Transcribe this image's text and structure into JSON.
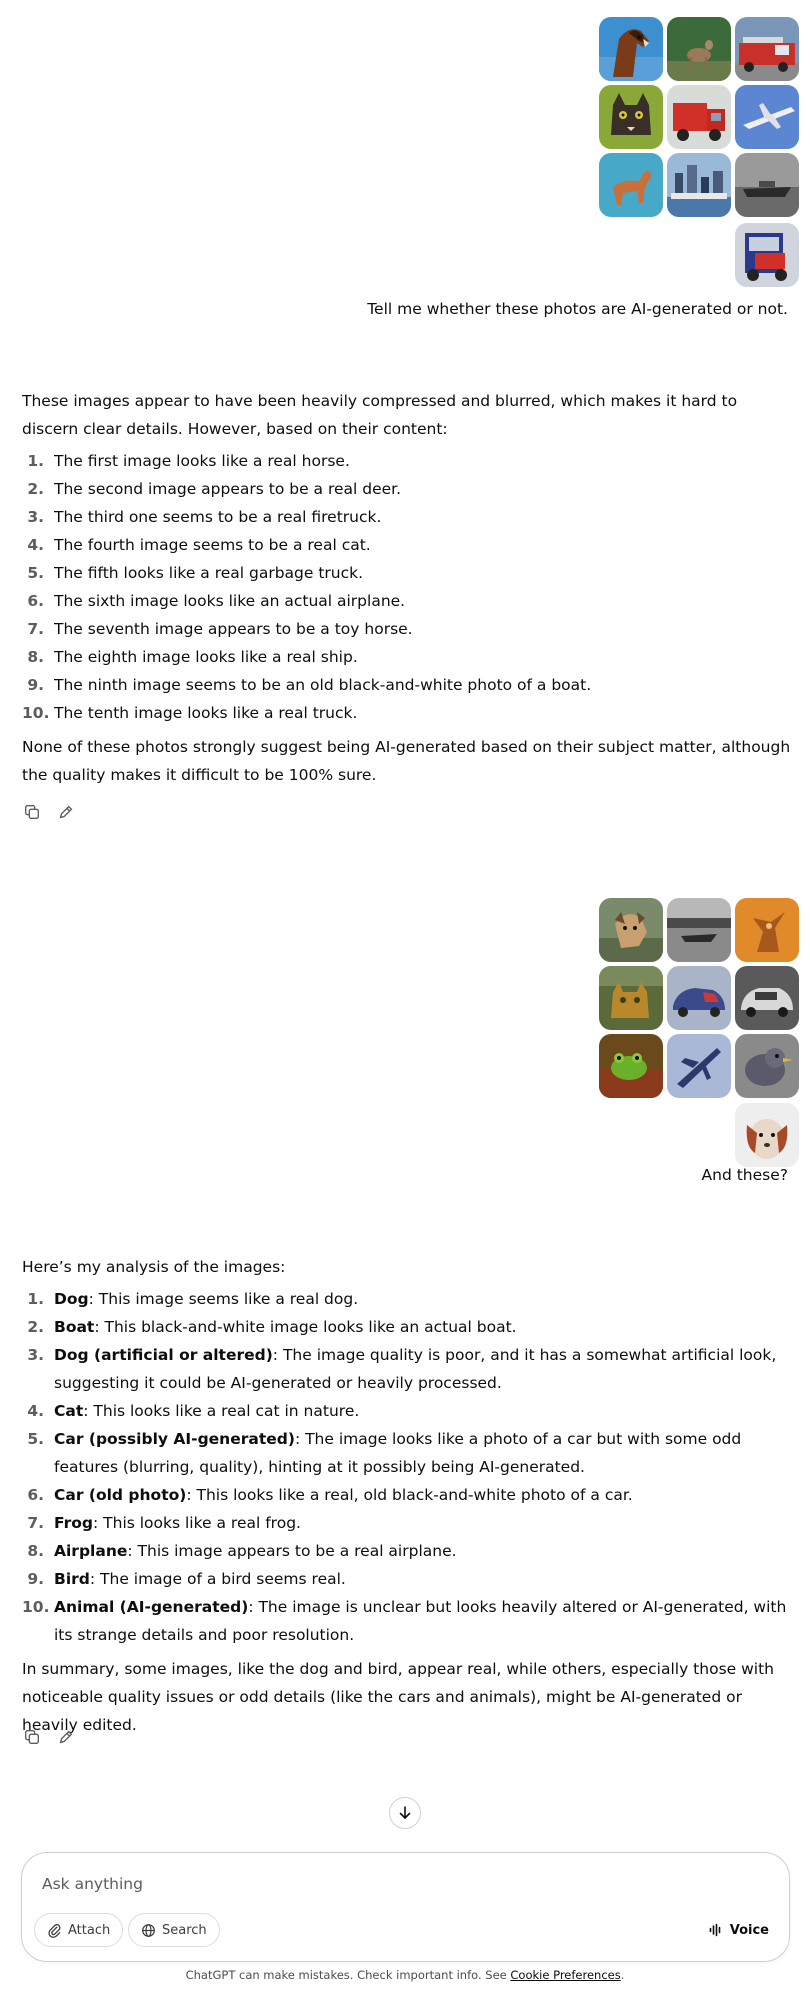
{
  "conversation": {
    "turn1": {
      "user_prompt": "Tell me whether these photos are AI-generated or not.",
      "assistant_intro": "These images appear to have been heavily compressed and blurred, which makes it hard to discern clear details. However, based on their content:",
      "items": [
        {
          "num": "1.",
          "text": "The first image looks like a real horse."
        },
        {
          "num": "2.",
          "text": "The second image appears to be a real deer."
        },
        {
          "num": "3.",
          "text": "The third one seems to be a real firetruck."
        },
        {
          "num": "4.",
          "text": "The fourth image seems to be a real cat."
        },
        {
          "num": "5.",
          "text": "The fifth looks like a real garbage truck."
        },
        {
          "num": "6.",
          "text": "The sixth image looks like an actual airplane."
        },
        {
          "num": "7.",
          "text": "The seventh image appears to be a toy horse."
        },
        {
          "num": "8.",
          "text": "The eighth image looks like a real ship."
        },
        {
          "num": "9.",
          "text": "The ninth image seems to be an old black-and-white photo of a boat."
        },
        {
          "num": "10.",
          "text": "The tenth image looks like a real truck."
        }
      ],
      "assistant_outro": "None of these photos strongly suggest being AI-generated based on their subject matter, although the quality makes it difficult to be 100% sure."
    },
    "turn2": {
      "user_prompt": "And these?",
      "assistant_intro": "Here’s my analysis of the images:",
      "items": [
        {
          "num": "1.",
          "title": "Dog",
          "text": ": This image seems like a real dog."
        },
        {
          "num": "2.",
          "title": "Boat",
          "text": ": This black-and-white image looks like an actual boat."
        },
        {
          "num": "3.",
          "title": "Dog (artificial or altered)",
          "text": ": The image quality is poor, and it has a somewhat artificial look, suggesting it could be AI-generated or heavily processed."
        },
        {
          "num": "4.",
          "title": "Cat",
          "text": ": This looks like a real cat in nature."
        },
        {
          "num": "5.",
          "title": "Car (possibly AI-generated)",
          "text": ": The image looks like a photo of a car but with some odd features (blurring, quality), hinting at it possibly being AI-generated."
        },
        {
          "num": "6.",
          "title": "Car (old photo)",
          "text": ": This looks like a real, old black-and-white photo of a car."
        },
        {
          "num": "7.",
          "title": "Frog",
          "text": ": This looks like a real frog."
        },
        {
          "num": "8.",
          "title": "Airplane",
          "text": ": This image appears to be a real airplane."
        },
        {
          "num": "9.",
          "title": "Bird",
          "text": ": The image of a bird seems real."
        },
        {
          "num": "10.",
          "title": "Animal (AI-generated)",
          "text": ": The image is unclear but looks heavily altered or AI-generated, with its strange details and poor resolution."
        }
      ],
      "assistant_outro": "In summary, some images, like the dog and bird, appear real, while others, especially those with noticeable quality issues or odd details (like the cars and animals), might be AI-generated or heavily edited."
    }
  },
  "thumbnails_set1": [
    "horse",
    "deer",
    "firetruck",
    "cat",
    "garbage-truck",
    "airplane",
    "toy-horse",
    "ship",
    "bw-boat",
    "truck"
  ],
  "thumbnails_set2": [
    "dog",
    "bw-boat",
    "dog-altered",
    "cat",
    "car",
    "bw-car",
    "frog",
    "airplane",
    "bird",
    "animal"
  ],
  "icons": {
    "copy": "copy-icon",
    "edit": "edit-icon",
    "scroll_down": "arrow-down-icon",
    "attach": "paperclip-icon",
    "search": "globe-icon",
    "voice": "voice-waveform-icon"
  },
  "composer": {
    "placeholder": "Ask anything",
    "attach_label": "Attach",
    "search_label": "Search",
    "voice_label": "Voice"
  },
  "footer": {
    "text": "ChatGPT can make mistakes. Check important info. See ",
    "link": "Cookie Preferences",
    "end": "."
  }
}
